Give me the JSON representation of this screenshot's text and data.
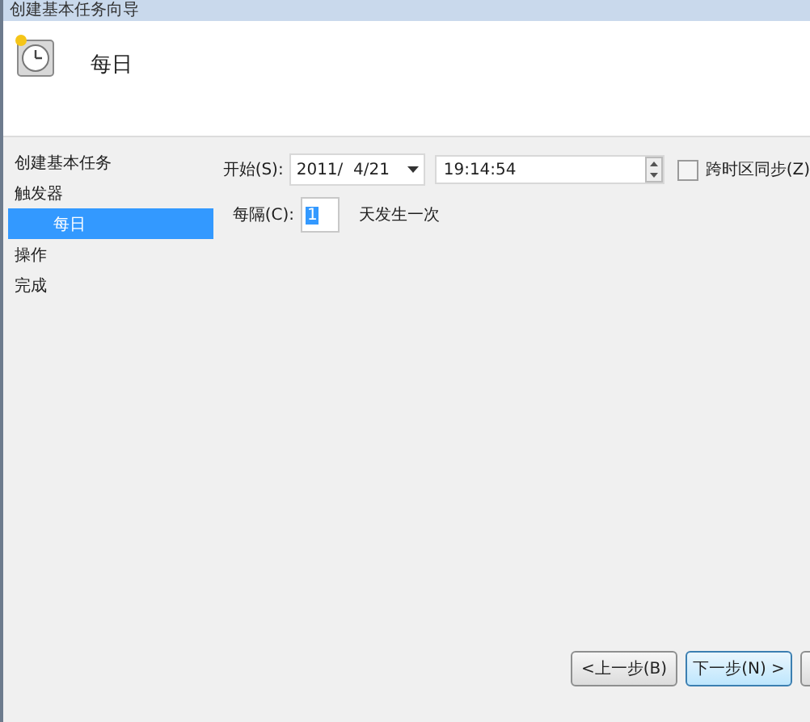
{
  "window": {
    "title": "创建基本任务向导"
  },
  "header": {
    "title": "每日"
  },
  "sidebar": {
    "items": [
      {
        "label": "创建基本任务",
        "selected": false
      },
      {
        "label": "触发器",
        "selected": false,
        "children": [
          {
            "label": "每日",
            "selected": true
          }
        ]
      },
      {
        "label": "操作",
        "selected": false
      },
      {
        "label": "完成",
        "selected": false
      }
    ]
  },
  "start": {
    "label": "开始(S):",
    "date": "2011/  4/21",
    "time": "19:14:54",
    "sync": {
      "label": "跨时区同步(Z)",
      "checked": false
    }
  },
  "recur": {
    "label": "每隔(C):",
    "value": "1",
    "suffix": "天发生一次"
  },
  "buttons": [
    {
      "label": "<上一步(B)",
      "default": false
    },
    {
      "label": "下一步(N) >",
      "default": true
    }
  ]
}
